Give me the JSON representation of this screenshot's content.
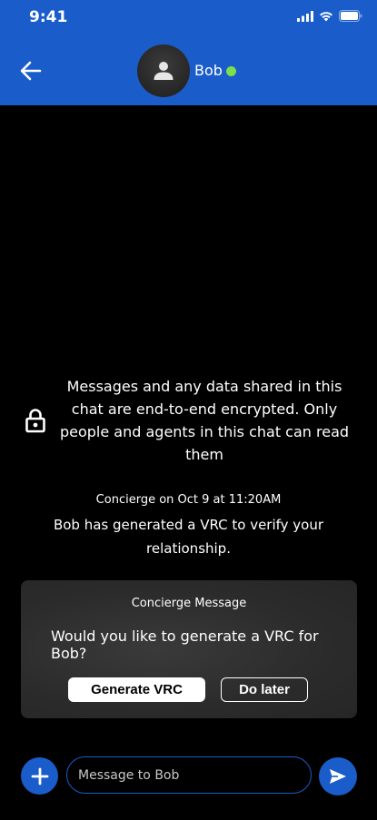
{
  "status_bar": {
    "time": "9:41",
    "icons": [
      "signal-icon",
      "wifi-icon",
      "battery-icon"
    ]
  },
  "header": {
    "back_icon": "arrow-left-icon",
    "avatar_icon": "person-icon",
    "contact_name": "Bob",
    "online_status_color": "#7be04c",
    "background_color": "#1a5cc9"
  },
  "encryption_notice": {
    "icon": "lock-icon",
    "text": "Messages and any data shared in this chat are end-to-end encrypted. Only people and agents in this chat can read them"
  },
  "system_message": {
    "meta": "Concierge on Oct 9 at 11:20AM",
    "text": "Bob has generated a VRC to verify your relationship."
  },
  "concierge_card": {
    "title": "Concierge Message",
    "question": "Would you like to generate a VRC for Bob?",
    "primary_button": "Generate VRC",
    "secondary_button": "Do later"
  },
  "composer": {
    "add_icon": "plus-icon",
    "placeholder": "Message to Bob",
    "send_icon": "send-icon"
  }
}
